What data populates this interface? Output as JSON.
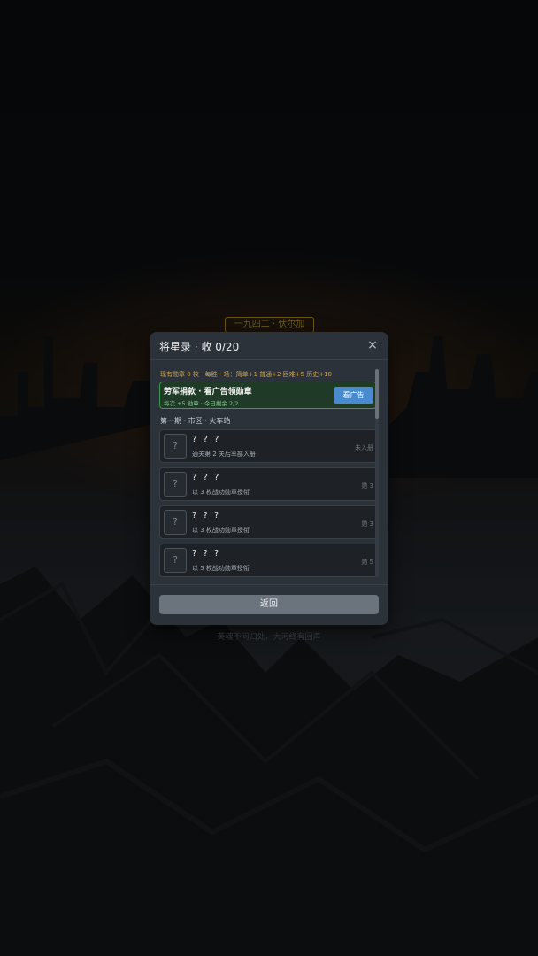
{
  "background": {
    "banner": "一九四二 · 伏尔加",
    "tagline": "英魂不问归处，大河终有回声"
  },
  "modal": {
    "title": "将星录 · 收 0/20",
    "close_glyph": "×",
    "info": "现有勋章 0 枚 · 每胜一场：简单+1 普通+2 困难+5 历史+10",
    "ad": {
      "title": "劳军捐款 · 看广告领勋章",
      "subtitle": "每次 +5 勋章 · 今日剩余 2/2",
      "button": "看广告"
    },
    "section": "第一期 · 市区 · 火车站",
    "entries": [
      {
        "icon": "?",
        "name": "? ? ?",
        "desc": "通关第 2 关后率部入册",
        "status": "未入册"
      },
      {
        "icon": "?",
        "name": "? ? ?",
        "desc": "以 3 枚战功勋章授衔",
        "status": "勋 3"
      },
      {
        "icon": "?",
        "name": "? ? ?",
        "desc": "以 3 枚战功勋章授衔",
        "status": "勋 3"
      },
      {
        "icon": "?",
        "name": "? ? ?",
        "desc": "以 5 枚战功勋章授衔",
        "status": "勋 5"
      }
    ],
    "back_button": "返回"
  },
  "colors": {
    "accent_gold": "#c9a250",
    "ad_green": "#3e9a4c",
    "ad_button_blue": "#4a8bcf",
    "panel": "#2c323a"
  }
}
